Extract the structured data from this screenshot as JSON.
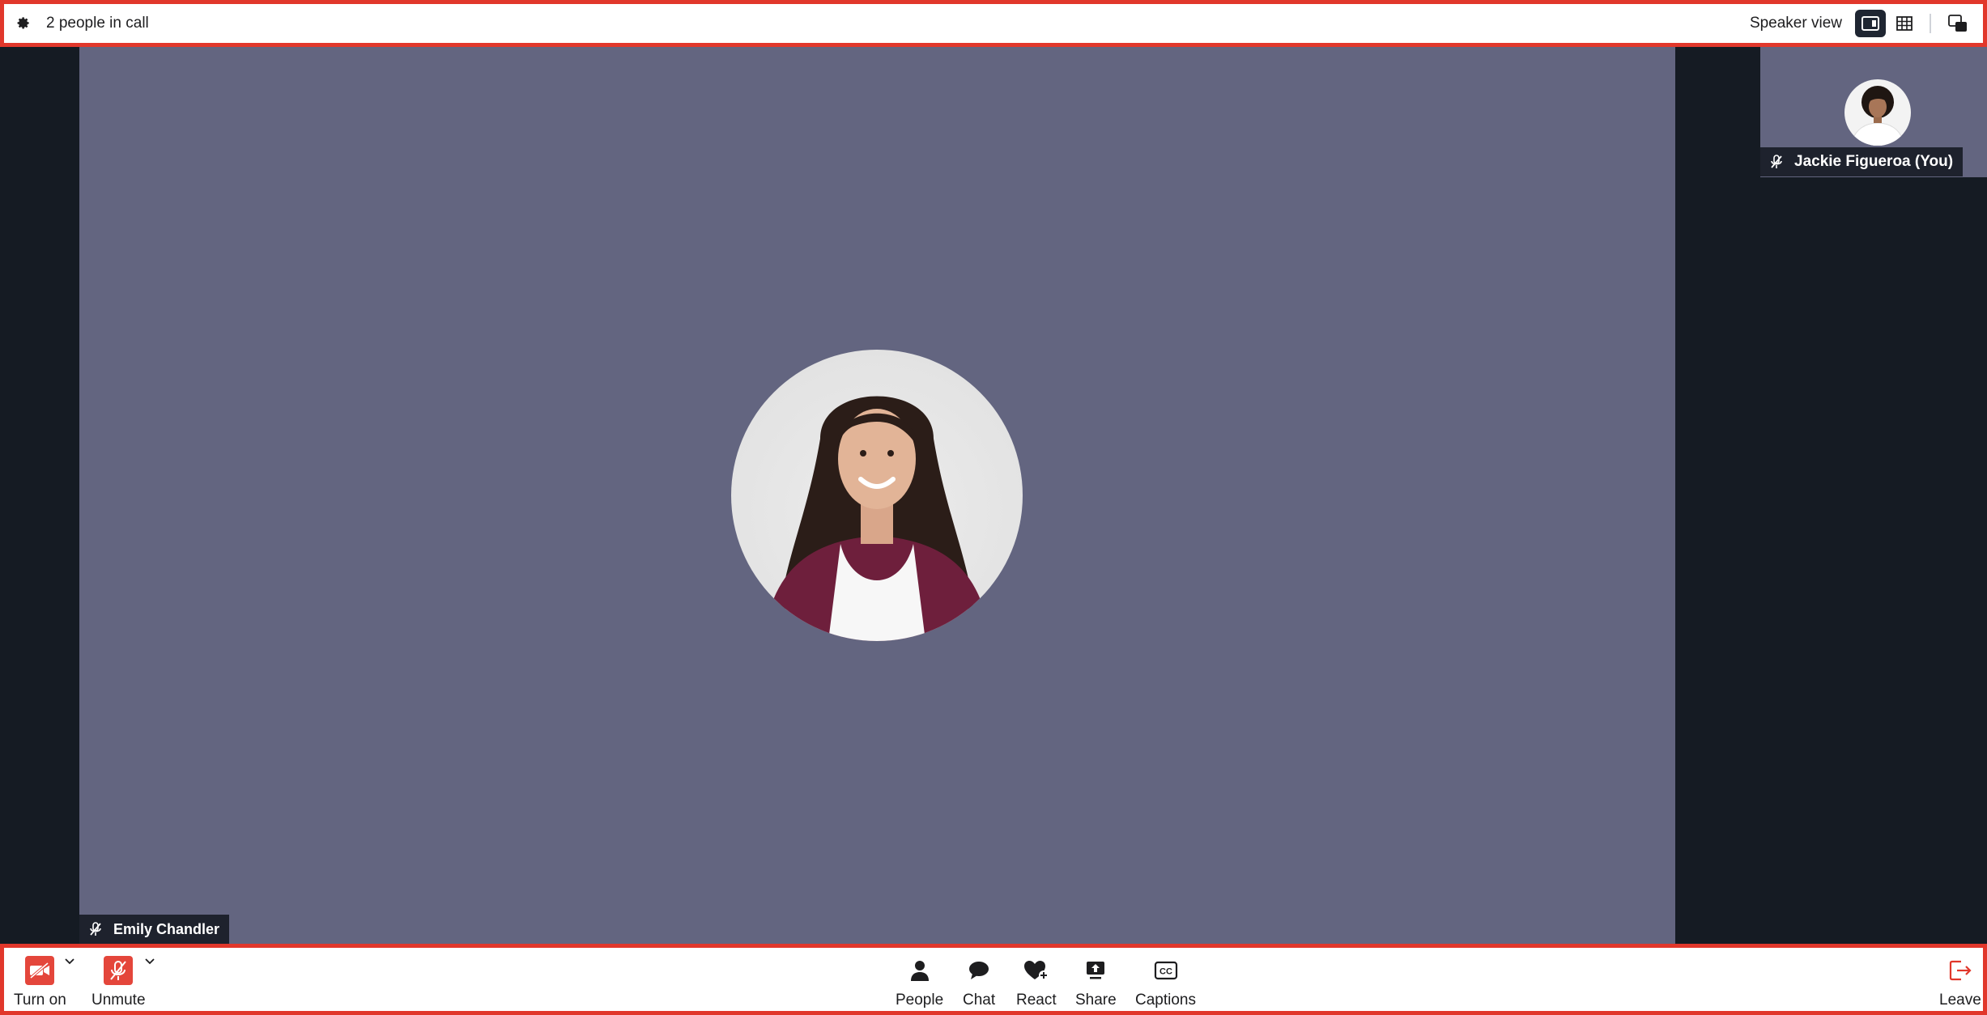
{
  "topbar": {
    "participant_count": "2 people in call",
    "view_label": "Speaker view",
    "icons": [
      "gear-icon",
      "speaker-view-icon",
      "grid-view-icon",
      "picture-in-picture-icon"
    ]
  },
  "main_participant": {
    "name": "Emily Chandler",
    "muted": true
  },
  "self_participant": {
    "name": "Jackie Figueroa (You)",
    "muted": true
  },
  "toolbar": {
    "camera_label": "Turn on",
    "mic_label": "Unmute",
    "people_label": "People",
    "chat_label": "Chat",
    "react_label": "React",
    "share_label": "Share",
    "captions_label": "Captions",
    "leave_label": "Leave"
  },
  "colors": {
    "accent_red": "#e1372b",
    "tile_bg": "#636580",
    "stage_bg": "#151b23"
  }
}
